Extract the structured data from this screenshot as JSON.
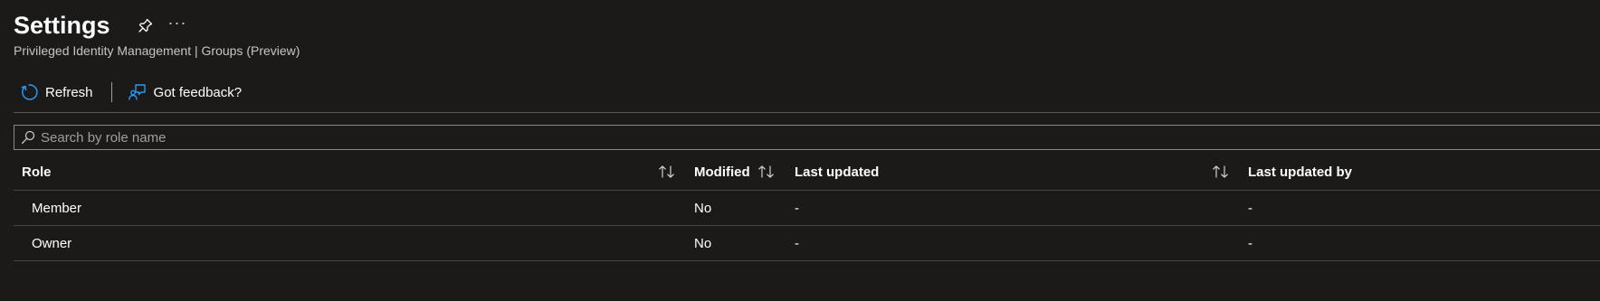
{
  "header": {
    "title": "Settings",
    "subtitle": "Privileged Identity Management | Groups (Preview)",
    "more_label": "···"
  },
  "toolbar": {
    "refresh_label": "Refresh",
    "feedback_label": "Got feedback?"
  },
  "search": {
    "placeholder": "Search by role name",
    "value": ""
  },
  "table": {
    "columns": [
      "Role",
      "Modified",
      "Last updated",
      "Last updated by"
    ],
    "rows": [
      {
        "role": "Member",
        "modified": "No",
        "last_updated": "-",
        "last_updated_by": "-"
      },
      {
        "role": "Owner",
        "modified": "No",
        "last_updated": "-",
        "last_updated_by": "-"
      }
    ]
  },
  "colors": {
    "background": "#1b1a19",
    "accent": "#2899f5",
    "text": "#ffffff",
    "muted_text": "#c8c6c4",
    "border": "#484644"
  },
  "icons": [
    "pin-icon",
    "more-icon",
    "refresh-icon",
    "feedback-icon",
    "search-icon",
    "sort-icon"
  ]
}
